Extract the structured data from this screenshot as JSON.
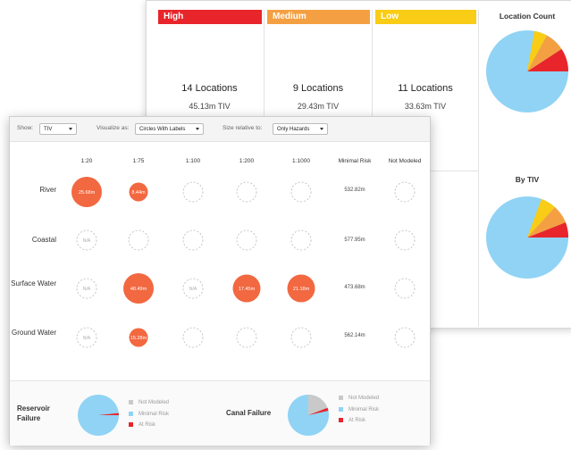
{
  "colors": {
    "high": "#e8252b",
    "medium": "#f4a042",
    "low": "#f9cc15",
    "circle_fill": "#f26840",
    "minimal_risk": "#90d3f5",
    "not_modeled": "#c9c9c9",
    "at_risk": "#e8252b"
  },
  "summary": {
    "columns": [
      {
        "title": "High",
        "locations": "14 Locations",
        "tiv": "45.13m TIV"
      },
      {
        "title": "Medium",
        "locations": "9 Locations",
        "tiv": "29.43m TIV"
      },
      {
        "title": "Low",
        "locations": "11 Locations",
        "tiv": "33.63m TIV"
      }
    ],
    "location_count_title": "Location Count",
    "by_tiv_title": "By TIV"
  },
  "toolbar": {
    "show_label": "Show:",
    "show_value": "TIV",
    "visualize_label": "Visualize as:",
    "visualize_value": "Circles With Labels",
    "size_label": "Size relative to:",
    "size_value": "Only Hazards"
  },
  "grid": {
    "columns": [
      "1:20",
      "1:75",
      "1:100",
      "1:200",
      "1:1000",
      "Minimal Risk",
      "Not Modeled"
    ],
    "rows": [
      {
        "label": "River",
        "cells": [
          {
            "kind": "filled",
            "label": "25.68m",
            "size": "large"
          },
          {
            "kind": "filled",
            "label": "8.44m",
            "size": "small"
          },
          {
            "kind": "empty"
          },
          {
            "kind": "empty"
          },
          {
            "kind": "empty"
          }
        ],
        "minimal_risk": "532.82m"
      },
      {
        "label": "Coastal",
        "cells": [
          {
            "kind": "na",
            "label": "N/A"
          },
          {
            "kind": "empty"
          },
          {
            "kind": "empty"
          },
          {
            "kind": "empty"
          },
          {
            "kind": "empty"
          }
        ],
        "minimal_risk": "577.95m"
      },
      {
        "label": "Surface Water",
        "cells": [
          {
            "kind": "na",
            "label": "N/A"
          },
          {
            "kind": "filled",
            "label": "48.49m",
            "size": "large"
          },
          {
            "kind": "na",
            "label": "N/A"
          },
          {
            "kind": "filled",
            "label": "17.45m",
            "size": "medium"
          },
          {
            "kind": "filled",
            "label": "21.18m",
            "size": "medium"
          }
        ],
        "minimal_risk": "473.68m"
      },
      {
        "label": "Ground Water",
        "cells": [
          {
            "kind": "na",
            "label": "N/A"
          },
          {
            "kind": "filled",
            "label": "15.28m",
            "size": "small"
          },
          {
            "kind": "empty"
          },
          {
            "kind": "empty"
          },
          {
            "kind": "empty"
          }
        ],
        "minimal_risk": "562.14m"
      }
    ]
  },
  "footer": {
    "reservoir_label": "Reservoir Failure",
    "canal_label": "Canal Failure",
    "legend": [
      "Not Modeled",
      "Minimal Risk",
      "At Risk"
    ]
  }
}
